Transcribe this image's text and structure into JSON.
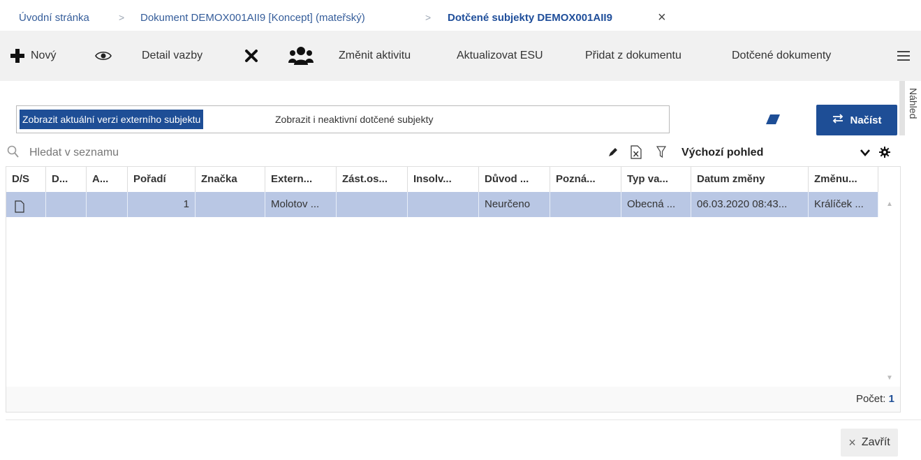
{
  "breadcrumb": {
    "items": [
      "Úvodní stránka",
      "Dokument DEMOX001AII9 [Koncept] (mateřský)",
      "Dotčené subjekty DEMOX001AII9"
    ],
    "separator": ">"
  },
  "toolbar": {
    "new_label": "Nový",
    "detail_label": "Detail vazby",
    "change_activity_label": "Změnit aktivitu",
    "update_esu_label": "Aktualizovat ESU",
    "add_from_doc_label": "Přidat z dokumentu",
    "affected_docs_label": "Dotčené dokumenty"
  },
  "side_panel": {
    "label": "Náhled"
  },
  "filters": {
    "active": "Zobrazit aktuální verzi externího subjektu",
    "inactive": "Zobrazit i neaktivní dotčené subjekty"
  },
  "load_button": "Načíst",
  "search": {
    "placeholder": "Hledat v seznamu"
  },
  "view": {
    "label": "Výchozí pohled"
  },
  "table": {
    "columns": [
      "D/S",
      "D...",
      "A...",
      "Pořadí",
      "Značka",
      "Extern...",
      "Zást.os...",
      "Insolv...",
      "Důvod ...",
      "Pozná...",
      "Typ va...",
      "Datum změny",
      "Změnu..."
    ],
    "rows": [
      {
        "ds": "",
        "d": "",
        "a": "",
        "poradi": "1",
        "znacka": "",
        "extern": "Molotov ...",
        "zast": "",
        "insolv": "",
        "duvod": "Neurčeno",
        "pozna": "",
        "typ": "Obecná ...",
        "datum": "06.03.2020 08:43...",
        "zmenu": "Králíček ..."
      }
    ]
  },
  "footer": {
    "count_label": "Počet:",
    "count_value": "1"
  },
  "close_button": "Zavřít",
  "colors": {
    "accent": "#1e4e96",
    "selected_row": "#b9c7e4",
    "toolbar_bg": "#f1f1f1"
  }
}
